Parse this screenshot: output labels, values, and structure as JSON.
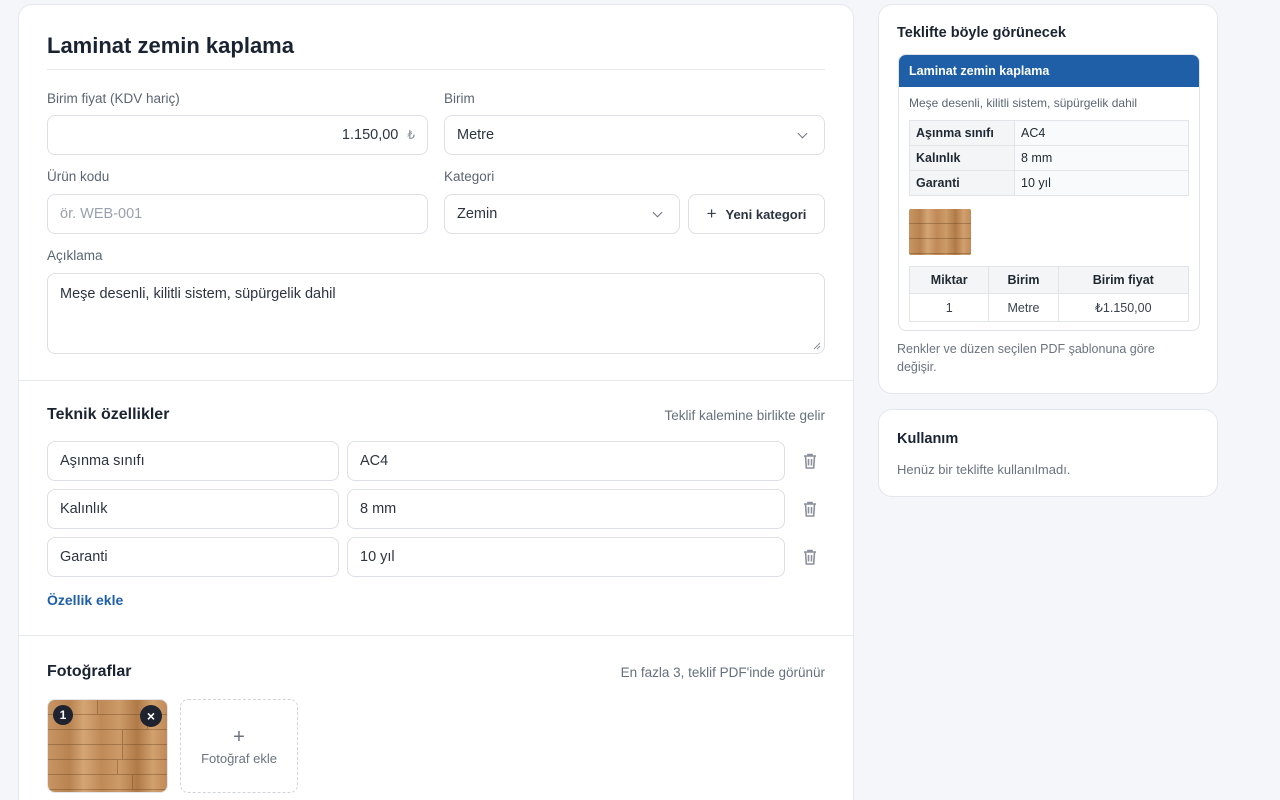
{
  "product": {
    "title": "Laminat zemin kaplama",
    "price_label": "Birim fiyat (KDV hariç)",
    "price_value": "1.150,00",
    "currency_symbol": "₺",
    "unit_label": "Birim",
    "unit_value": "Metre",
    "code_label": "Ürün kodu",
    "code_placeholder": "ör. WEB-001",
    "category_label": "Kategori",
    "category_value": "Zemin",
    "new_category_label": "Yeni kategori",
    "description_label": "Açıklama",
    "description_value": "Meşe desenli, kilitli sistem, süpürgelik dahil"
  },
  "specs": {
    "title": "Teknik özellikler",
    "hint": "Teklif kalemine birlikte gelir",
    "rows": [
      {
        "name": "Aşınma sınıfı",
        "value": "AC4"
      },
      {
        "name": "Kalınlık",
        "value": "8 mm"
      },
      {
        "name": "Garanti",
        "value": "10 yıl"
      }
    ],
    "add_label": "Özellik ekle"
  },
  "photos": {
    "title": "Fotoğraflar",
    "hint": "En fazla 3, teklif PDF'inde görünür",
    "badge": "1",
    "remove_symbol": "×",
    "add_symbol": "+",
    "add_label": "Fotoğraf ekle"
  },
  "preview": {
    "title": "Teklifte böyle görünecek",
    "header": "Laminat zemin kaplama",
    "description": "Meşe desenli, kilitli sistem, süpürgelik dahil",
    "specs": [
      {
        "name": "Aşınma sınıfı",
        "value": "AC4"
      },
      {
        "name": "Kalınlık",
        "value": "8 mm"
      },
      {
        "name": "Garanti",
        "value": "10 yıl"
      }
    ],
    "table_headers": [
      "Miktar",
      "Birim",
      "Birim fiyat"
    ],
    "table_row": [
      "1",
      "Metre",
      "₺1.150,00"
    ],
    "note": "Renkler ve düzen seçilen PDF şablonuna göre değişir."
  },
  "usage": {
    "title": "Kullanım",
    "text": "Henüz bir teklifte kullanılmadı."
  },
  "colors": {
    "accent": "#1f5fa8",
    "preview_header": "#1f5fa8"
  }
}
